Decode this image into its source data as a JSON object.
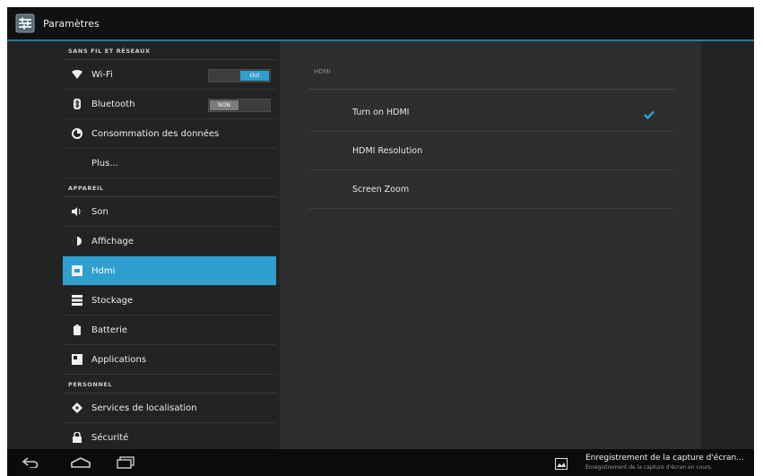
{
  "actionbar": {
    "title": "Paramètres",
    "icon": "settings-app-icon"
  },
  "settings_list": {
    "sections": [
      {
        "header": "SANS FIL ET RÉSEAUX",
        "items": [
          {
            "label": "Wi-Fi",
            "icon": "wifi-icon",
            "toggle": "on",
            "toggle_text": "OUI"
          },
          {
            "label": "Bluetooth",
            "icon": "bluetooth-icon",
            "toggle": "off",
            "toggle_text": "NON"
          },
          {
            "label": "Consommation des données",
            "icon": "data-usage-icon"
          },
          {
            "label": "Plus...",
            "icon": ""
          }
        ]
      },
      {
        "header": "APPAREIL",
        "items": [
          {
            "label": "Son",
            "icon": "volume-icon"
          },
          {
            "label": "Affichage",
            "icon": "display-icon"
          },
          {
            "label": "Hdmi",
            "icon": "hdmi-icon",
            "selected": true
          },
          {
            "label": "Stockage",
            "icon": "storage-icon"
          },
          {
            "label": "Batterie",
            "icon": "battery-icon"
          },
          {
            "label": "Applications",
            "icon": "apps-icon"
          }
        ]
      },
      {
        "header": "PERSONNEL",
        "items": [
          {
            "label": "Services de localisation",
            "icon": "location-icon"
          },
          {
            "label": "Sécurité",
            "icon": "lock-icon"
          }
        ]
      }
    ]
  },
  "hdmi_panel": {
    "header": "HDMI",
    "prefs": [
      {
        "label": "Turn on HDMI",
        "checked": true
      },
      {
        "label": "HDMI Resolution",
        "checked": false
      },
      {
        "label": "Screen Zoom",
        "checked": false
      }
    ]
  },
  "navbar": {
    "buttons": [
      "back-icon",
      "home-icon",
      "recent-apps-icon"
    ],
    "notification": {
      "title": "Enregistrement de la capture d'écran...",
      "subtitle": "Enregistrement de la capture d'écran en cours."
    }
  },
  "colors": {
    "accent": "#2f9fd0",
    "actionbar_line": "#2b7a93",
    "background": "#2b2b2b"
  }
}
